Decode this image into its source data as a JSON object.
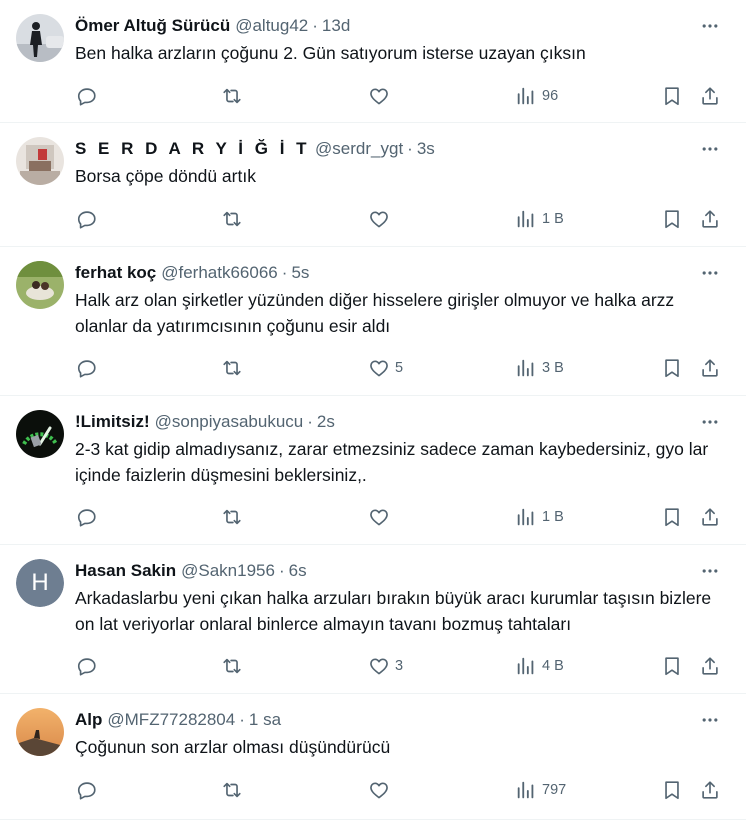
{
  "tweets": [
    {
      "name": "Ömer Altuğ Sürücü",
      "handle": "@altug42",
      "sep": "·",
      "time": "13d",
      "text": "Ben halka arzların çoğunu 2. Gün satıyorum isterse uzayan çıksın",
      "replies": "",
      "retweets": "",
      "likes": "",
      "views": "96",
      "avatar": "silhouette-avatar"
    },
    {
      "name": "S E R D A R Y İ Ğ İ T",
      "handle": "@serdr_ygt",
      "sep": "·",
      "time": "3s",
      "text": "Borsa çöpe döndü artık",
      "replies": "",
      "retweets": "",
      "likes": "",
      "views": "1 B",
      "avatar": "room-photo-avatar"
    },
    {
      "name": "ferhat koç",
      "handle": "@ferhatk66066",
      "sep": "·",
      "time": "5s",
      "text": "Halk arz olan şirketler yüzünden diğer hisselere girişler olmuyor ve halka arzz olanlar da yatırımcısının çoğunu esir aldı",
      "replies": "",
      "retweets": "",
      "likes": "5",
      "views": "3 B",
      "avatar": "outdoor-photo-avatar"
    },
    {
      "name": "!Limitsiz!",
      "handle": "@sonpiyasabukucu",
      "sep": "·",
      "time": "2s",
      "text": "2-3 kat gidip almadıysanız, zarar etmezsiniz sadece zaman kaybedersiniz, gyo lar içinde faizlerin düşmesini beklersiniz,.",
      "replies": "",
      "retweets": "",
      "likes": "",
      "views": "1 B",
      "avatar": "gauge-avatar"
    },
    {
      "name": "Hasan Sakin",
      "handle": "@Sakn1956",
      "sep": "·",
      "time": "6s",
      "text": "Arkadaslarbu yeni çıkan halka arzuları bırakın büyük aracı kurumlar taşısın bizlere on lat veriyorlar onlaral binlerce almayın tavanı bozmuş tahtaları",
      "replies": "",
      "retweets": "",
      "likes": "3",
      "views": "4 B",
      "avatar": "letter-avatar",
      "avatar_letter": "H"
    },
    {
      "name": "Alp",
      "handle": "@MFZ77282804",
      "sep": "·",
      "time": "1 sa",
      "text": "Çoğunun son arzlar olması düşündürücü",
      "replies": "",
      "retweets": "",
      "likes": "",
      "views": "797",
      "avatar": "sunset-photo-avatar"
    }
  ]
}
